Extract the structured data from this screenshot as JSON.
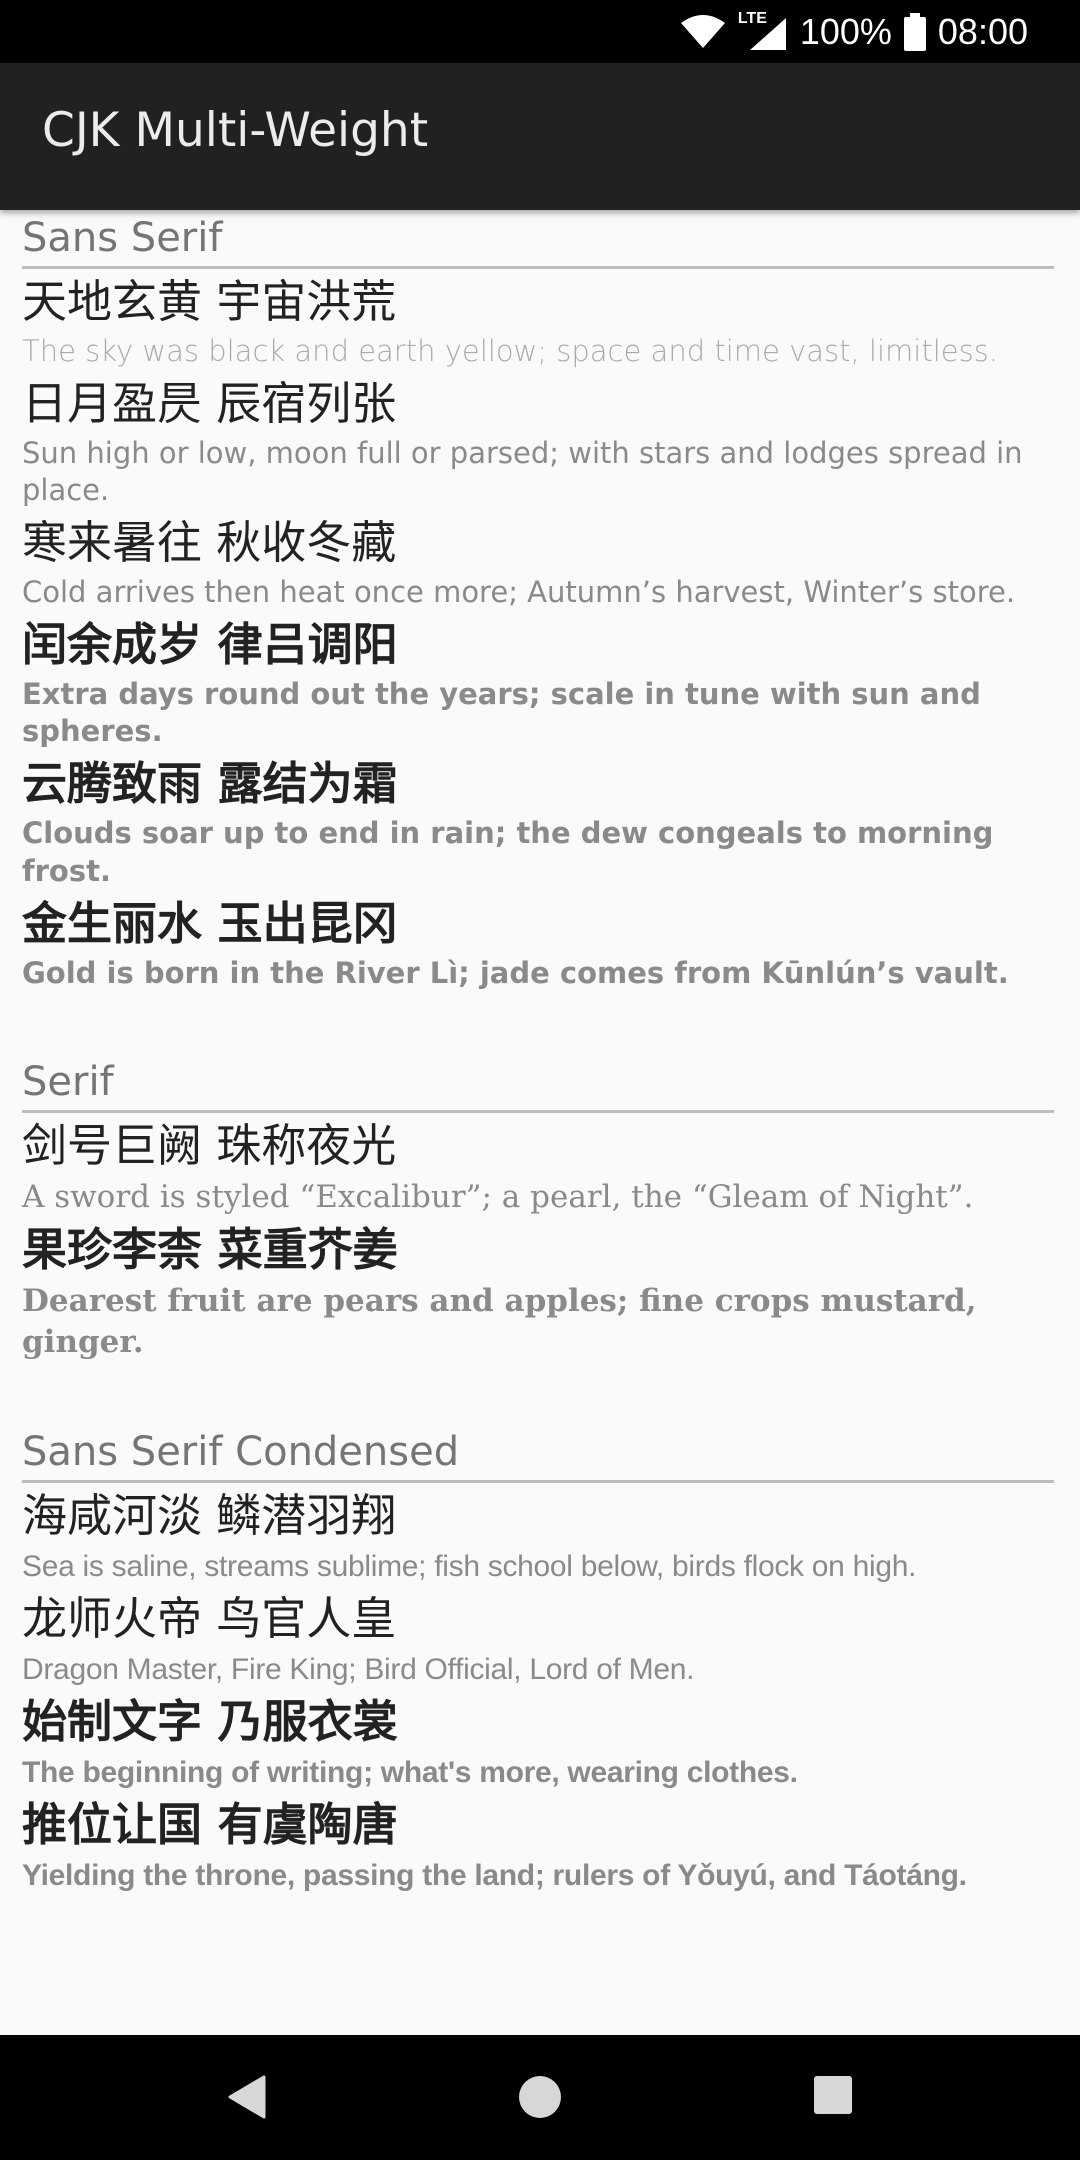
{
  "status_bar": {
    "network": "LTE",
    "battery": "100%",
    "time": "08:00"
  },
  "app_bar": {
    "title": "CJK Multi-Weight"
  },
  "sections": {
    "sans": {
      "title": "Sans Serif",
      "rows": [
        {
          "cjk": "天地玄黄 宇宙洪荒",
          "en": "The sky was black and earth yellow; space and time vast, limitless."
        },
        {
          "cjk": "日月盈昃 辰宿列张",
          "en": "Sun high or low, moon full or parsed; with stars and lodges spread in place."
        },
        {
          "cjk": "寒来暑往 秋收冬藏",
          "en": "Cold arrives then heat once more; Autumn’s harvest, Winter’s store."
        },
        {
          "cjk": "闰余成岁 律吕调阳",
          "en": "Extra days round out the years; scale in tune with sun and spheres."
        },
        {
          "cjk": "云腾致雨 露结为霜",
          "en": "Clouds soar up to end in rain; the dew congeals to morning frost."
        },
        {
          "cjk": "金生丽水 玉出昆冈",
          "en": "Gold is born in the River Lì; jade comes from Kūnlún’s vault."
        }
      ]
    },
    "serif": {
      "title": "Serif",
      "rows": [
        {
          "cjk": "剑号巨阙 珠称夜光",
          "en": "A sword is styled “Excalibur”; a pearl, the “Gleam of Night”."
        },
        {
          "cjk": "果珍李柰 菜重芥姜",
          "en": "Dearest fruit are pears and apples; fine crops mustard, ginger."
        }
      ]
    },
    "condensed": {
      "title": "Sans Serif Condensed",
      "rows": [
        {
          "cjk": "海咸河淡 鳞潜羽翔",
          "en": "Sea is saline, streams sublime; fish school below, birds flock on high."
        },
        {
          "cjk": "龙师火帝 鸟官人皇",
          "en": "Dragon Master, Fire King; Bird Official, Lord of Men."
        },
        {
          "cjk": "始制文字 乃服衣裳",
          "en": "The beginning of writing; what's more, wearing clothes."
        },
        {
          "cjk": "推位让国 有虞陶唐",
          "en": "Yielding the throne, passing the land; rulers of Yǒuyú, and Táotáng."
        }
      ]
    }
  },
  "nav_bar": {
    "icons": [
      "back-icon",
      "home-icon",
      "recents-icon"
    ]
  }
}
